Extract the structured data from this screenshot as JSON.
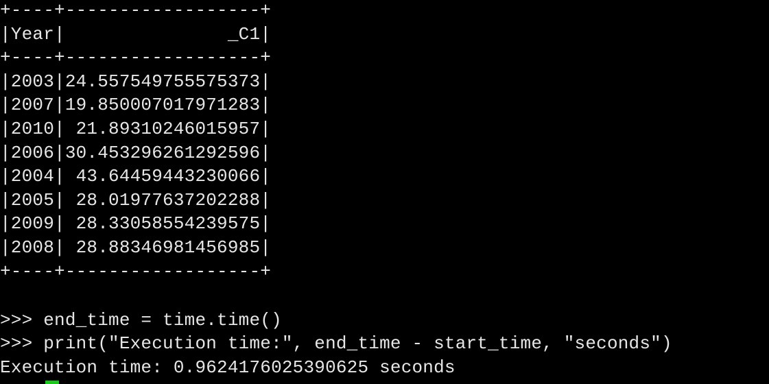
{
  "table": {
    "border": "+----+------------------+",
    "header": "|Year|               _C1|",
    "rows": [
      "|2003|24.557549755575373|",
      "|2007|19.850007017971283|",
      "|2010| 21.89310246015957|",
      "|2006|30.453296261292596|",
      "|2004| 43.64459443230066|",
      "|2005| 28.01977637202288|",
      "|2009| 28.33058554239575|",
      "|2008| 28.88346981456985|"
    ]
  },
  "console": {
    "lines": [
      ">>> end_time = time.time()",
      ">>> print(\"Execution time:\", end_time - start_time, \"seconds\")",
      "Execution time: 0.9624176025390625 seconds"
    ]
  },
  "colors": {
    "background": "#000000",
    "text": "#e6e6e6",
    "cursor": "#19c819"
  }
}
